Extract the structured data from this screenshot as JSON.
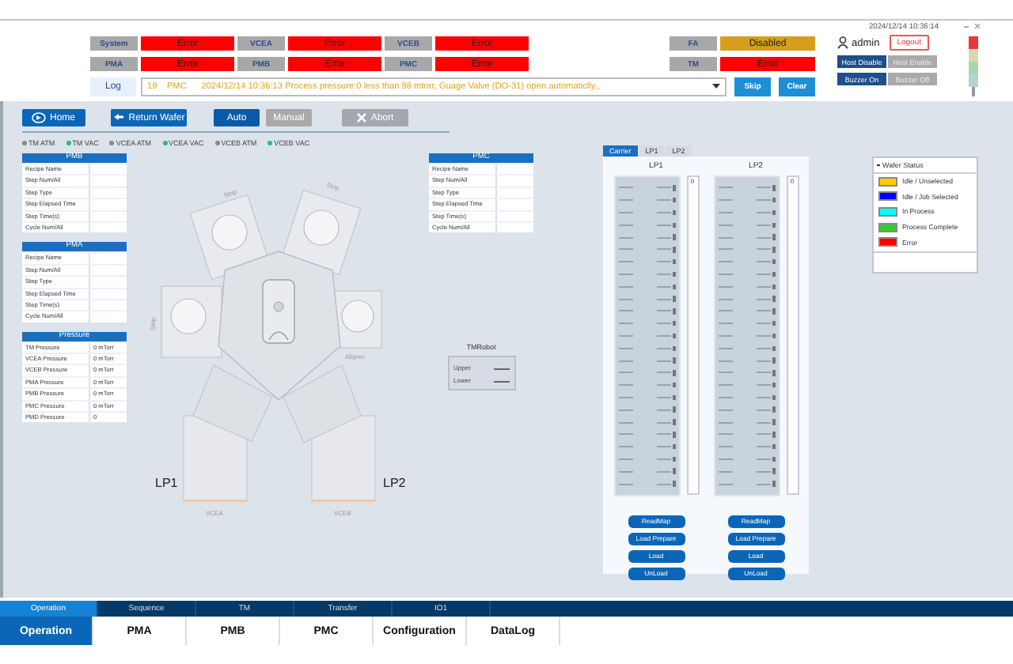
{
  "clock": "2024/12/14 10:36:14",
  "status": [
    {
      "label": "System",
      "value": "Error",
      "color": "#ff0000"
    },
    {
      "label": "VCEA",
      "value": "Error",
      "color": "#ff0000"
    },
    {
      "label": "VCEB",
      "value": "Error",
      "color": "#ff0000"
    },
    {
      "label": "FA",
      "value": "Disabled",
      "color": "#d69e1b"
    },
    {
      "label": "PMA",
      "value": "Error",
      "color": "#ff0000"
    },
    {
      "label": "PMB",
      "value": "Error",
      "color": "#ff0000"
    },
    {
      "label": "PMC",
      "value": "Error",
      "color": "#ff0000"
    },
    {
      "label": "TM",
      "value": "Error",
      "color": "#ff0000"
    }
  ],
  "log": {
    "label": "Log",
    "message": "19    PMC      2024/12/14 10:36:13 Process pressure:0 less than 98 mtorr, Guage Valve (DO-31) open automaticlly.,",
    "buttons": [
      "Skip",
      "Clear"
    ]
  },
  "user": {
    "name": "admin",
    "logout": "Logout"
  },
  "host_buttons": [
    {
      "label": "Host Disable",
      "selected": true
    },
    {
      "label": "Host Enable",
      "selected": false
    }
  ],
  "buzzer_buttons": [
    {
      "label": "Buzzer On",
      "selected": true
    },
    {
      "label": "Buzzer Off",
      "selected": false
    }
  ],
  "actions": [
    {
      "label": "Home",
      "kind": "home"
    },
    {
      "label": "Return Wafer",
      "kind": "return"
    }
  ],
  "modes": [
    {
      "label": "Auto",
      "selected": true
    },
    {
      "label": "Manual",
      "selected": false
    }
  ],
  "abort": {
    "label": "Abort",
    "disabled": true
  },
  "indicators": [
    {
      "label": "TM ATM",
      "on": false
    },
    {
      "label": "TM VAC",
      "on": true
    },
    {
      "label": "VCEA ATM",
      "on": false
    },
    {
      "label": "VCEA VAC",
      "on": true
    },
    {
      "label": "VCEB ATM",
      "on": false
    },
    {
      "label": "VCEB VAC",
      "on": true
    }
  ],
  "left_tables": [
    {
      "title": "PMB",
      "rows": [
        {
          "name": "Recipe Name"
        },
        {
          "name": "Step Num/All"
        },
        {
          "name": "Step Type"
        },
        {
          "name": "Step Elapsed Time"
        },
        {
          "name": "Step Time(s)"
        },
        {
          "name": "Cycle Num/All"
        }
      ]
    },
    {
      "title": "PMA",
      "rows": [
        {
          "name": "Recipe Name"
        },
        {
          "name": "Step Num/All"
        },
        {
          "name": "Step Type"
        },
        {
          "name": "Step Elapsed Time"
        },
        {
          "name": "Step Time(s)"
        },
        {
          "name": "Cycle Num/All"
        }
      ]
    },
    {
      "title": "Pressure",
      "rows": [
        {
          "name": "TM Pressure",
          "value": "0 mTorr"
        },
        {
          "name": "VCEA Pressure",
          "value": "0 mTorr"
        },
        {
          "name": "VCEB Pressure",
          "value": "0 mTorr"
        },
        {
          "name": "PMA Pressure",
          "value": "0 mTorr"
        },
        {
          "name": "PMB Pressure",
          "value": "0 mTorr"
        },
        {
          "name": "PMC Pressure",
          "value": "0 mTorr"
        },
        {
          "name": "PMD Pressure",
          "value": "0"
        }
      ]
    }
  ],
  "right_table": {
    "title": "PMC",
    "rows": [
      {
        "name": "Recipe Name"
      },
      {
        "name": "Step Num/All"
      },
      {
        "name": "Step Type"
      },
      {
        "name": "Step Elapsed Time"
      },
      {
        "name": "Step Time(s)"
      },
      {
        "name": "Cycle Num/All"
      }
    ]
  },
  "chamber_labels": {
    "top_left": "Strip",
    "top_right": "Strip",
    "left": "Strip",
    "right": "Aligner",
    "bottom_left": "VCEA",
    "bottom_right": "VCEB",
    "lp_left": "LP1",
    "lp_right": "LP2"
  },
  "tm_robot": {
    "title": "TMRobot",
    "arms": [
      "Upper",
      "Lower"
    ]
  },
  "carrier": {
    "tabs": [
      {
        "label": "Carrier",
        "selected": true
      },
      {
        "label": "LP1",
        "selected": false
      },
      {
        "label": "LP2",
        "selected": false
      }
    ],
    "ports": [
      {
        "title": "LP1",
        "count": "0",
        "buttons": [
          "ReadMap",
          "Load Prepare",
          "Load",
          "UnLoad"
        ]
      },
      {
        "title": "LP2",
        "count": "0",
        "buttons": [
          "ReadMap",
          "Load Prepare",
          "Load",
          "UnLoad"
        ]
      }
    ]
  },
  "wafer_status": {
    "title": "Wafer Status",
    "items": [
      {
        "label": "Idle / Unselected",
        "color": "#ffcc00"
      },
      {
        "label": "Idle / Job Selected",
        "color": "#0000ff"
      },
      {
        "label": "In Process",
        "color": "#00ffff"
      },
      {
        "label": "Process Complete",
        "color": "#33cc33"
      },
      {
        "label": "Error",
        "color": "#ff0000"
      }
    ]
  },
  "sub_tabs": [
    {
      "label": "Operation",
      "selected": true
    },
    {
      "label": "Sequence",
      "selected": false
    },
    {
      "label": "TM",
      "selected": false
    },
    {
      "label": "Transfer",
      "selected": false
    },
    {
      "label": "IO1",
      "selected": false
    }
  ],
  "main_tabs": [
    {
      "label": "Operation",
      "selected": true
    },
    {
      "label": "PMA",
      "selected": false
    },
    {
      "label": "PMB",
      "selected": false
    },
    {
      "label": "PMC",
      "selected": false
    },
    {
      "label": "Configuration",
      "selected": false
    },
    {
      "label": "DataLog",
      "selected": false
    }
  ]
}
